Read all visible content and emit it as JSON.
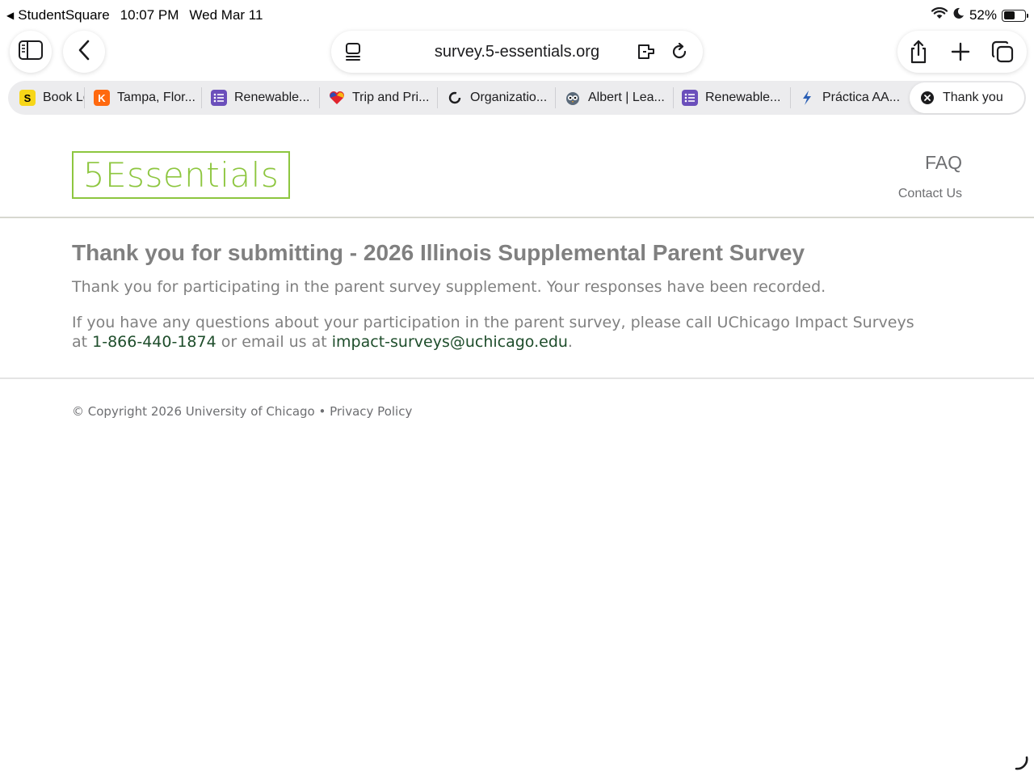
{
  "status_bar": {
    "back_app": "StudentSquare",
    "time": "10:07 PM",
    "date": "Wed Mar 11",
    "battery": "52%",
    "battery_level": 0.52
  },
  "toolbar": {
    "url": "survey.5-essentials.org"
  },
  "tabs": [
    {
      "label": "Book Lo",
      "icon": "S",
      "icon_bg": "#f7d618",
      "icon_fg": "#000000"
    },
    {
      "label": "Tampa, Flor...",
      "icon": "K",
      "icon_bg": "#ff690f",
      "icon_fg": "#ffffff"
    },
    {
      "label": "Renewable...",
      "icon": "list",
      "icon_bg": "#6b4fbb",
      "icon_fg": "#ffffff"
    },
    {
      "label": "Trip and Pri...",
      "icon": "heart",
      "icon_bg": "",
      "icon_fg": ""
    },
    {
      "label": "Organizatio...",
      "icon": "ring",
      "icon_bg": "",
      "icon_fg": ""
    },
    {
      "label": "Albert | Lea...",
      "icon": "owl",
      "icon_bg": "",
      "icon_fg": ""
    },
    {
      "label": "Renewable...",
      "icon": "list",
      "icon_bg": "#6b4fbb",
      "icon_fg": "#ffffff"
    },
    {
      "label": "Práctica AA...",
      "icon": "bolt",
      "icon_bg": "",
      "icon_fg": ""
    },
    {
      "label": "Thank you",
      "icon": "close",
      "icon_bg": "",
      "icon_fg": ""
    }
  ],
  "header": {
    "logo_text": "5Essentials",
    "faq": "FAQ",
    "contact": "Contact Us",
    "brand_color": "#8dc63f"
  },
  "main": {
    "title": "Thank you for submitting - 2026 Illinois Supplemental Parent Survey",
    "paragraph1": "Thank you for participating in the parent survey supplement. Your responses have been recorded.",
    "paragraph2_before": "If you have any questions about your participation in the parent survey, please call UChicago Impact Surveys at ",
    "phone": "1-866-440-1874",
    "paragraph2_middle": " or email us at ",
    "email": "impact-surveys@uchicago.edu",
    "paragraph2_after": ".",
    "link_color": "#1e4d2b"
  },
  "footer": {
    "copyright": "© Copyright 2026 University of Chicago",
    "separator": " • ",
    "privacy": "Privacy Policy"
  }
}
